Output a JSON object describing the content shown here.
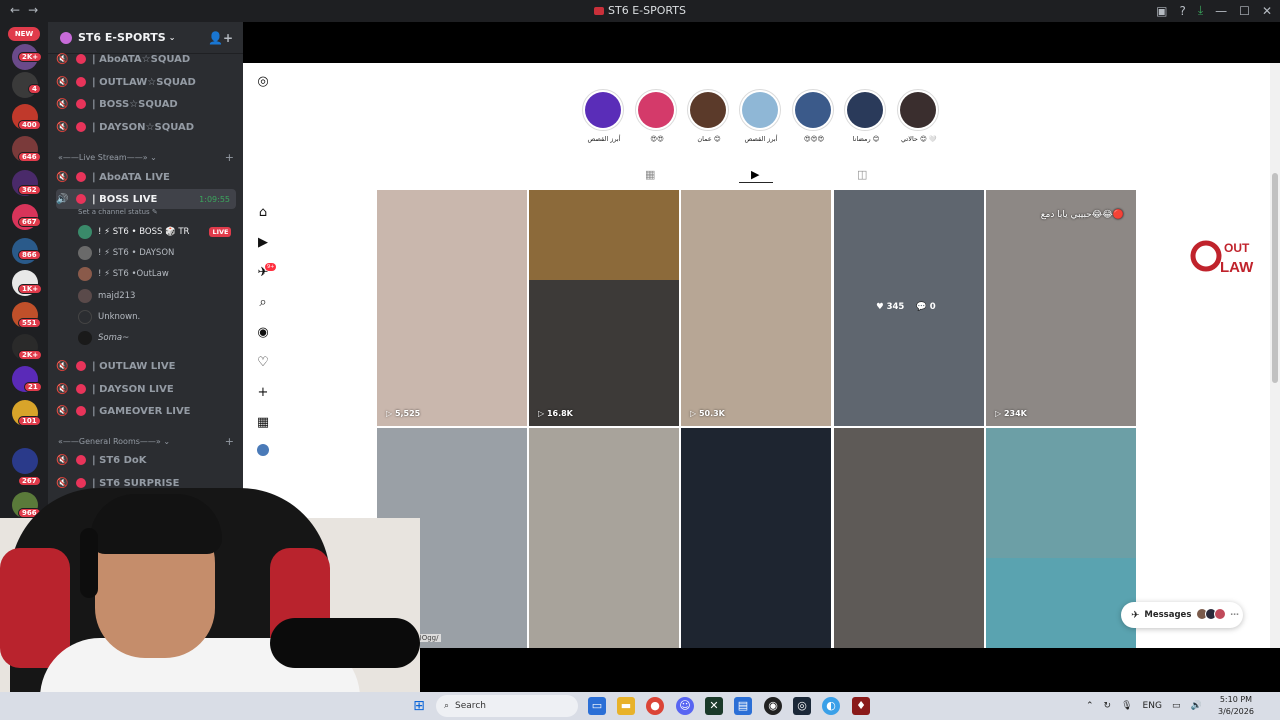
{
  "window": {
    "title": "ST6 E-SPORTS"
  },
  "server_rail": {
    "new_label": "NEW",
    "badges": [
      "2K+",
      "4",
      "400",
      "646",
      "362",
      "667",
      "866",
      "1K+",
      "551",
      "2K+",
      "21",
      "101",
      "267",
      "966"
    ]
  },
  "sidebar": {
    "guild_name": "ST6 E-SPORTS",
    "squads": [
      "| AboATA☆SQUAD",
      "| OUTLAW☆SQUAD",
      "| BOSS☆SQUAD",
      "| DAYSON☆SQUAD"
    ],
    "live_category": "«——Live Stream——»",
    "live_channels": [
      "| AboATA LIVE",
      "| BOSS LIVE",
      "| OUTLAW LIVE",
      "| DAYSON LIVE",
      "| GAMEOVER LIVE"
    ],
    "active_timer": "1:09:55",
    "status_placeholder": "Set a channel status",
    "users": [
      "! ⚡ ST6 • BOSS 🎲 TR",
      "! ⚡ ST6 • DAYSON",
      "! ⚡ ST6 •OutLaw",
      "majd213",
      "Unknown.",
      "Soma~"
    ],
    "live_badge": "LIVE",
    "general_category": "«——General Rooms——»",
    "general_channels": [
      "| ST6 DoK",
      "| ST6 SURPRISE"
    ]
  },
  "instagram": {
    "highlights": [
      {
        "label": "أبرز القصص",
        "color": "#5a2db8"
      },
      {
        "label": "😍😍",
        "color": "#d43a6a"
      },
      {
        "label": "عمان 😊",
        "color": "#5b3a2a"
      },
      {
        "label": "أبرز القصص",
        "color": "#8fb7d6"
      },
      {
        "label": "😍😍😍",
        "color": "#3b5a8a"
      },
      {
        "label": "رمضانا 😊",
        "color": "#2a3a5a"
      },
      {
        "label": "حالاتي 😊 🤍",
        "color": "#3a2e2e"
      }
    ],
    "tabs": [
      "grid-icon",
      "reels-icon",
      "tagged-icon"
    ],
    "posts": [
      {
        "views": "5,525",
        "color": "#c9b7ad"
      },
      {
        "views": "16.8K",
        "color": "#3d3a38"
      },
      {
        "views": "50.3K",
        "color": "#b7a695"
      },
      {
        "views": "",
        "color": "#7f8894",
        "likes": "345",
        "comments": "0"
      },
      {
        "views": "234K",
        "color": "#8d8885",
        "overlay": "حبيبي يابا دمع😂😂🔴"
      },
      {
        "views": "",
        "color": "#9aa0a6"
      },
      {
        "views": "",
        "color": "#a8a39b"
      },
      {
        "views": "",
        "color": "#1e2530"
      },
      {
        "views": "",
        "color": "#5e5a57"
      },
      {
        "views": "",
        "color": "#6c9fa6"
      }
    ],
    "messages_label": "Messages",
    "logo_text": "OUT LAW",
    "ogg_tag": ")Ogg/"
  },
  "taskbar": {
    "search_placeholder": "Search",
    "lang": "ENG",
    "time": "5:10 PM",
    "date": "3/6/2026"
  },
  "colors": {
    "discord_bg": "#2b2d31",
    "live_red": "#e03b4b",
    "accent_pink": "#e8345a",
    "timer_green": "#3ba55d"
  }
}
